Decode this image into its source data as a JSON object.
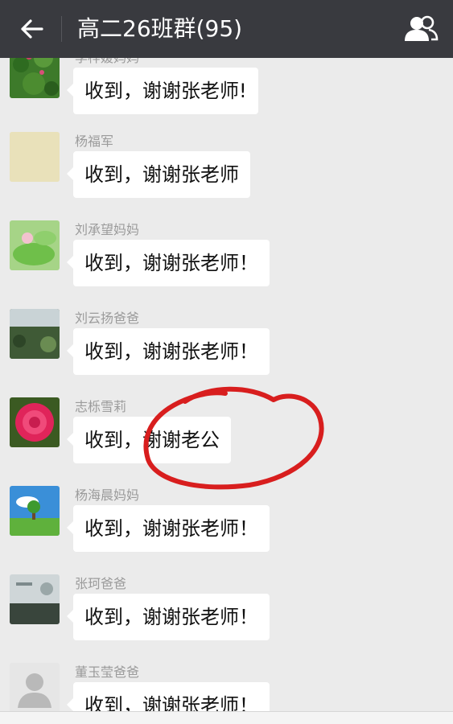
{
  "header": {
    "title": "高二26班群(95)",
    "back_icon": "back-arrow-icon",
    "members_icon": "group-members-icon",
    "bg_color": "#393a3f"
  },
  "messages": [
    {
      "sender": "李梓媛妈妈",
      "text": "收到，谢谢张老师!"
    },
    {
      "sender": "杨福军",
      "text": "收到，谢谢张老师"
    },
    {
      "sender": "刘承望妈妈",
      "text": "收到，谢谢张老师！"
    },
    {
      "sender": "刘云扬爸爸",
      "text": "收到，谢谢张老师！"
    },
    {
      "sender": "志栎雪莉",
      "text": "收到，谢谢老公"
    },
    {
      "sender": "杨海晨妈妈",
      "text": "收到，谢谢张老师！"
    },
    {
      "sender": "张珂爸爸",
      "text": "收到，谢谢张老师！"
    },
    {
      "sender": "董玉莹爸爸",
      "text": "收到，谢谢张老师！"
    }
  ],
  "annotation": {
    "type": "red-hand-drawn-circle",
    "color": "#d81e1e"
  },
  "colors": {
    "chat_bg": "#ebebeb",
    "bubble": "#ffffff",
    "sender_text": "#9b9b9b"
  }
}
